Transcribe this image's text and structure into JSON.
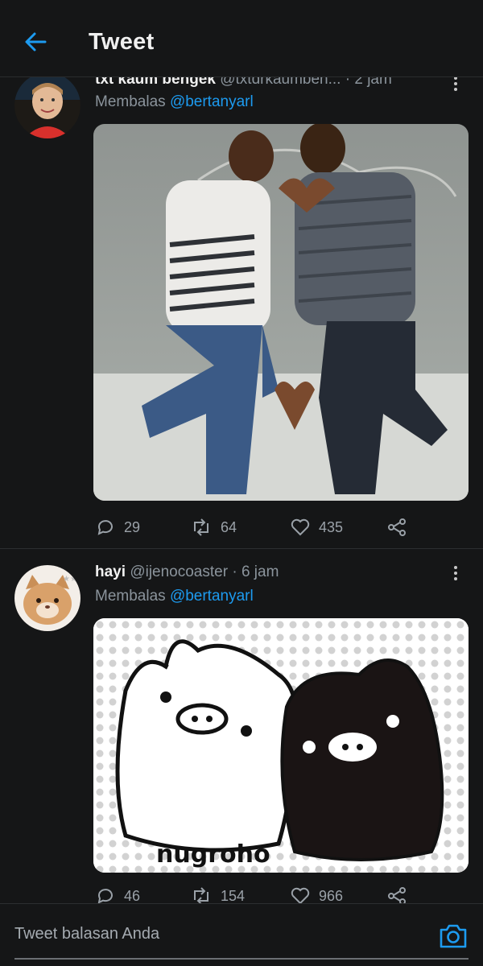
{
  "header": {
    "title": "Tweet",
    "back_icon": "arrow-left-icon",
    "accent": "#1d9bf0"
  },
  "tweets": [
    {
      "name": "txt kaum bengek",
      "handle": "@txtdrkaumben...",
      "time": "· 2 jam",
      "reply_prefix": "Membalas",
      "reply_to": "@bertanyarl",
      "media": "photo of two young men making heart shapes with hands and feet against a chalkboard wall",
      "replies": "29",
      "retweets": "64",
      "likes": "435"
    },
    {
      "name": "hayi",
      "handle": "@ijenocoaster",
      "time": "· 6 jam",
      "reply_prefix": "Membalas",
      "reply_to": "@bertanyarl",
      "media_caption": "nugroho",
      "replies": "46",
      "retweets": "154",
      "likes": "966"
    }
  ],
  "composer": {
    "placeholder": "Tweet balasan Anda",
    "camera_icon": "camera-icon"
  }
}
